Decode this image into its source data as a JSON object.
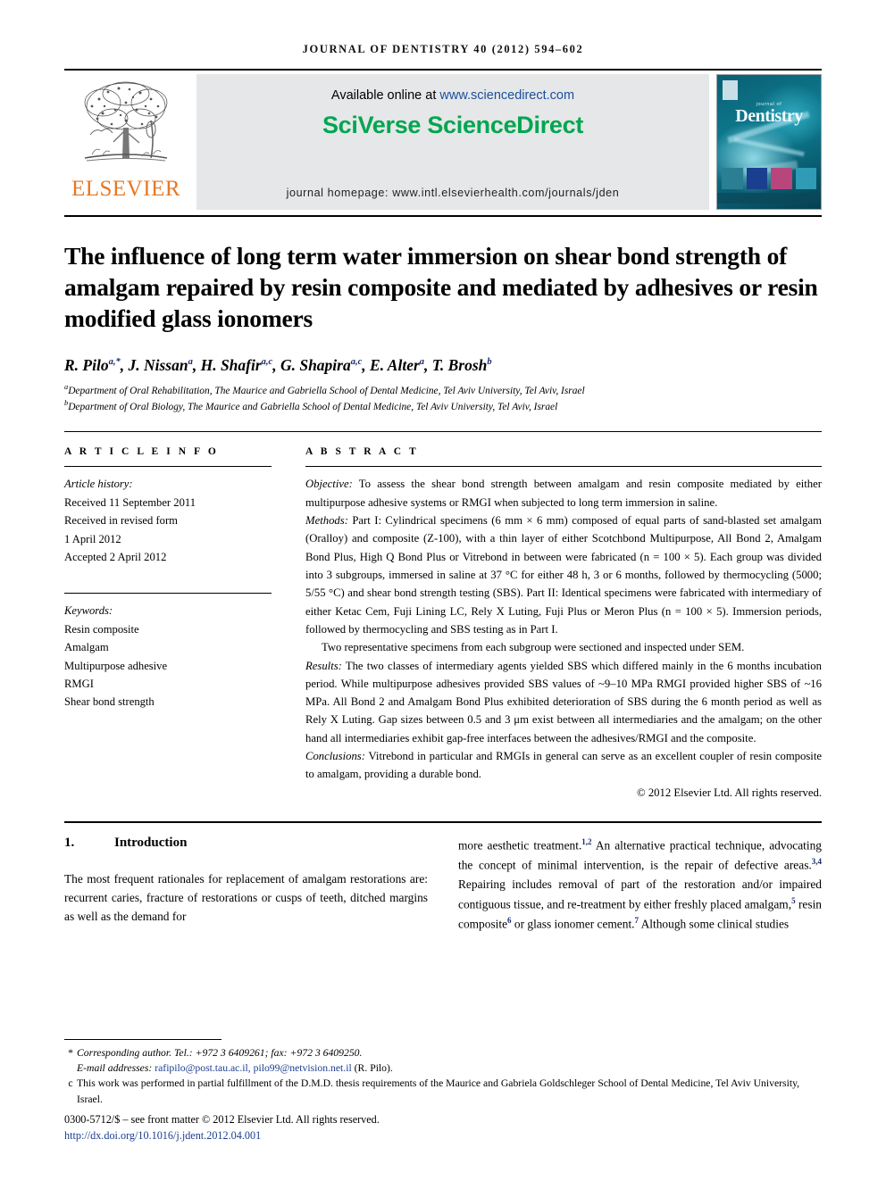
{
  "running_head": "JOURNAL OF DENTISTRY 40 (2012) 594–602",
  "masthead": {
    "publisher_name": "ELSEVIER",
    "publisher_logo_alt": "elsevier-tree-logo",
    "available_online_prefix": "Available online at ",
    "available_online_url": "www.sciencedirect.com",
    "brand": "SciVerse ScienceDirect",
    "brand_color": "#00a650",
    "homepage": "journal homepage: www.intl.elsevierhealth.com/journals/jden",
    "cover": {
      "kicker": "journal of",
      "title": "Dentistry"
    }
  },
  "article": {
    "title": "The influence of long term water immersion on shear bond strength of amalgam repaired by resin composite and mediated by adhesives or resin modified glass ionomers",
    "authors_line": "R. Pilo a,*, J. Nissan a, H. Shafir a,c, G. Shapira a,c, E. Alter a, T. Brosh b",
    "authors": [
      {
        "name": "R. Pilo",
        "marks": "a,*"
      },
      {
        "name": "J. Nissan",
        "marks": "a"
      },
      {
        "name": "H. Shafir",
        "marks": "a,c"
      },
      {
        "name": "G. Shapira",
        "marks": "a,c"
      },
      {
        "name": "E. Alter",
        "marks": "a"
      },
      {
        "name": "T. Brosh",
        "marks": "b"
      }
    ],
    "affiliations": [
      {
        "mark": "a",
        "text": "Department of Oral Rehabilitation, The Maurice and Gabriella School of Dental Medicine, Tel Aviv University, Tel Aviv, Israel"
      },
      {
        "mark": "b",
        "text": "Department of Oral Biology, The Maurice and Gabriella School of Dental Medicine, Tel Aviv University, Tel Aviv, Israel"
      }
    ]
  },
  "article_info": {
    "heading": "A R T I C L E  I N F O",
    "history_label": "Article history:",
    "history": [
      "Received 11 September 2011",
      "Received in revised form",
      "1 April 2012",
      "Accepted 2 April 2012"
    ],
    "keywords_label": "Keywords:",
    "keywords": [
      "Resin composite",
      "Amalgam",
      "Multipurpose adhesive",
      "RMGI",
      "Shear bond strength"
    ]
  },
  "abstract": {
    "heading": "A B S T R A C T",
    "objective_label": "Objective:",
    "objective_text": " To assess the shear bond strength between amalgam and resin composite mediated by either multipurpose adhesive systems or RMGI when subjected to long term immersion in saline.",
    "methods_label": "Methods:",
    "methods_text": " Part I: Cylindrical specimens (6 mm × 6 mm) composed of equal parts of sand-blasted set amalgam (Oralloy) and composite (Z-100), with a thin layer of either Scotchbond Multipurpose, All Bond 2, Amalgam Bond Plus, High Q Bond Plus or Vitrebond in between were fabricated (n = 100 × 5). Each group was divided into 3 subgroups, immersed in saline at 37 °C for either 48 h, 3 or 6 months, followed by thermocycling (5000; 5/55 °C) and shear bond strength testing (SBS). Part II: Identical specimens were fabricated with intermediary of either Ketac Cem, Fuji Lining LC, Rely X Luting, Fuji Plus or Meron Plus (n = 100 × 5). Immersion periods, followed by thermocycling and SBS testing as in Part I.",
    "sem_paragraph": "Two representative specimens from each subgroup were sectioned and inspected under SEM.",
    "results_label": "Results:",
    "results_text": " The two classes of intermediary agents yielded SBS which differed mainly in the 6 months incubation period. While multipurpose adhesives provided SBS values of ~9–10 MPa RMGI provided higher SBS of ~16 MPa. All Bond 2 and Amalgam Bond Plus exhibited deterioration of SBS during the 6 month period as well as Rely X Luting. Gap sizes between 0.5 and 3 μm exist between all intermediaries and the amalgam; on the other hand all intermediaries exhibit gap-free interfaces between the adhesives/RMGI and the composite.",
    "conclusions_label": "Conclusions:",
    "conclusions_text": " Vitrebond in particular and RMGIs in general can serve as an excellent coupler of resin composite to amalgam, providing a durable bond.",
    "copyright": "© 2012 Elsevier Ltd. All rights reserved."
  },
  "introduction": {
    "number": "1.",
    "heading": "Introduction",
    "col_left": "The most frequent rationales for replacement of amalgam restorations are: recurrent caries, fracture of restorations or cusps of teeth, ditched margins as well as the demand for",
    "col_right_parts": [
      {
        "t": "more aesthetic treatment."
      },
      {
        "sup": "1,2"
      },
      {
        "t": " An alternative practical technique, advocating the concept of minimal intervention, is the repair of defective areas."
      },
      {
        "sup": "3,4"
      },
      {
        "t": " Repairing includes removal of part of the restoration and/or impaired contiguous tissue, and re-treatment by either freshly placed amalgam,"
      },
      {
        "sup": "5"
      },
      {
        "t": " resin composite"
      },
      {
        "sup": "6"
      },
      {
        "t": " or glass ionomer cement."
      },
      {
        "sup": "7"
      },
      {
        "t": " Although some clinical studies"
      }
    ]
  },
  "footnotes": {
    "corresponding": "Corresponding author. Tel.: +972 3 6409261; fax: +972 3 6409250.",
    "email_label": "E-mail addresses: ",
    "emails": "rafipilo@post.tau.ac.il, pilo99@netvision.net.il",
    "email_suffix": " (R. Pilo).",
    "thesis_mark": "c",
    "thesis_note": "This work was performed in partial fulfillment of the D.M.D. thesis requirements of the Maurice and Gabriela Goldschleger School of Dental Medicine, Tel Aviv University, Israel.",
    "issn_line": "0300-5712/$ – see front matter © 2012 Elsevier Ltd. All rights reserved.",
    "doi": "http://dx.doi.org/10.1016/j.jdent.2012.04.001"
  }
}
